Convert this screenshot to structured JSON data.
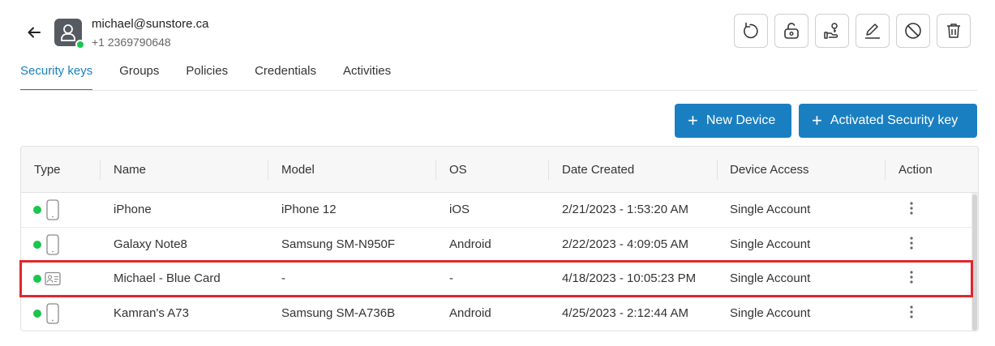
{
  "user": {
    "email": "michael@sunstore.ca",
    "phone": "+1 2369790648",
    "online": true
  },
  "header_actions": [
    {
      "icon": "reset-icon"
    },
    {
      "icon": "unlock-icon"
    },
    {
      "icon": "hand-key-icon"
    },
    {
      "icon": "edit-icon"
    },
    {
      "icon": "block-icon"
    },
    {
      "icon": "delete-icon"
    }
  ],
  "tabs": [
    {
      "label": "Security keys",
      "active": true
    },
    {
      "label": "Groups",
      "active": false
    },
    {
      "label": "Policies",
      "active": false
    },
    {
      "label": "Credentials",
      "active": false
    },
    {
      "label": "Activities",
      "active": false
    }
  ],
  "buttons": {
    "new_device": "New Device",
    "activated_key": "Activated Security key"
  },
  "table": {
    "columns": [
      "Type",
      "Name",
      "Model",
      "OS",
      "Date Created",
      "Device Access",
      "Action"
    ],
    "rows": [
      {
        "type_icon": "phone-icon",
        "name": "iPhone",
        "model": "iPhone 12",
        "os": "iOS",
        "date": "2/21/2023 - 1:53:20 AM",
        "access": "Single Account"
      },
      {
        "type_icon": "phone-icon",
        "name": "Galaxy Note8",
        "model": "Samsung SM-N950F",
        "os": "Android",
        "date": "2/22/2023 - 4:09:05 AM",
        "access": "Single Account"
      },
      {
        "type_icon": "id-card-icon",
        "name": "Michael - Blue Card",
        "model": "-",
        "os": "-",
        "date": "4/18/2023 - 10:05:23 PM",
        "access": "Single Account"
      },
      {
        "type_icon": "phone-icon",
        "name": "Kamran's A73",
        "model": "Samsung SM-A736B",
        "os": "Android",
        "date": "4/25/2023 - 2:12:44 AM",
        "access": "Single Account"
      }
    ]
  },
  "colors": {
    "accent": "#1a7fc1",
    "online": "#1cc450",
    "highlight": "#e0262d"
  }
}
